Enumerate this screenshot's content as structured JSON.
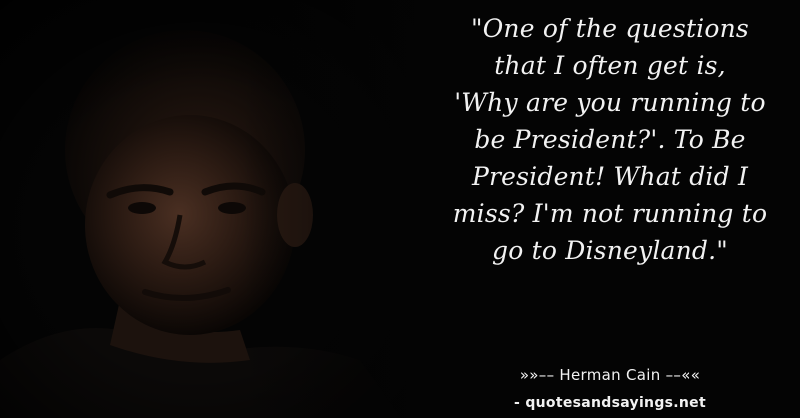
{
  "quote": {
    "lines": [
      "\"One of the questions",
      "that I often get is,",
      "'Why are you running to",
      "be President?'. To Be",
      "President! What did I",
      "miss? I'm not running to",
      "go to Disneyland.\""
    ]
  },
  "attribution": {
    "text": "»»–– Herman Cain ––««"
  },
  "source": {
    "text": "- quotesandsayings.net"
  },
  "colors": {
    "background": "#040404",
    "text": "#f2f2f2"
  }
}
